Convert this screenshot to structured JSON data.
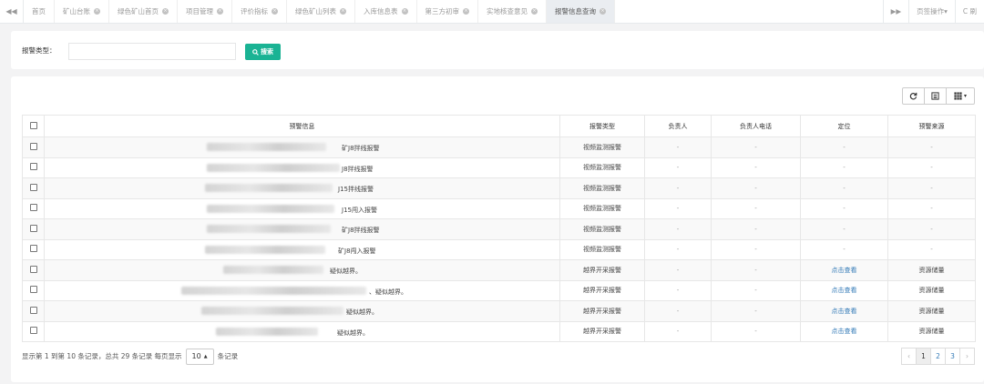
{
  "tabbar": {
    "nav_left_icon": "double-chevron-left-icon",
    "tabs": [
      {
        "label": "首页",
        "closable": false
      },
      {
        "label": "矿山台账",
        "closable": true
      },
      {
        "label": "绿色矿山首页",
        "closable": true
      },
      {
        "label": "项目管理",
        "closable": true
      },
      {
        "label": "评价指标",
        "closable": true
      },
      {
        "label": "绿色矿山列表",
        "closable": true
      },
      {
        "label": "入库信息表",
        "closable": true
      },
      {
        "label": "第三方初审",
        "closable": true
      },
      {
        "label": "实地核查意见",
        "closable": true
      },
      {
        "label": "报警信息查询",
        "closable": true,
        "active": true
      }
    ],
    "nav_right_icon": "double-chevron-right-icon",
    "page_ops_label": "页签操作▾",
    "refresh_label": "C 刷"
  },
  "search": {
    "label": "报警类型：",
    "input_value": "",
    "button_label": "搜索",
    "button_icon": "search-icon",
    "accent": "#1ab394"
  },
  "toolbar": {
    "refresh_icon": "refresh-icon",
    "toggle_icon": "list-toggle-icon",
    "columns_icon": "grid-columns-icon"
  },
  "table": {
    "headers": [
      "预警信息",
      "报警类型",
      "负责人",
      "负责人电话",
      "定位",
      "预警来源"
    ],
    "rows": [
      {
        "info": "矿J8拌线报警",
        "type": "视频监测报警",
        "person": "-",
        "phone": "-",
        "location": "-",
        "source": "-"
      },
      {
        "info": "J8拌线报警",
        "type": "视频监测报警",
        "person": "-",
        "phone": "-",
        "location": "-",
        "source": "-"
      },
      {
        "info": "J15拌线报警",
        "type": "视频监测报警",
        "person": "-",
        "phone": "-",
        "location": "-",
        "source": "-"
      },
      {
        "info": "J15闯入报警",
        "type": "视频监测报警",
        "person": "-",
        "phone": "-",
        "location": "-",
        "source": "-"
      },
      {
        "info": "矿J8拌线报警",
        "type": "视频监测报警",
        "person": "-",
        "phone": "-",
        "location": "-",
        "source": "-"
      },
      {
        "info": "矿J8闯入报警",
        "type": "视频监测报警",
        "person": "-",
        "phone": "-",
        "location": "-",
        "source": "-"
      },
      {
        "info": "疑似越界。",
        "type": "越界开采报警",
        "person": "-",
        "phone": "-",
        "location": "点击查看",
        "source": "资源储量"
      },
      {
        "info": "、疑似越界。",
        "type": "越界开采报警",
        "person": "-",
        "phone": "-",
        "location": "点击查看",
        "source": "资源储量"
      },
      {
        "info": "疑似越界。",
        "type": "越界开采报警",
        "person": "-",
        "phone": "-",
        "location": "点击查看",
        "source": "资源储量"
      },
      {
        "info": "疑似越界。",
        "type": "越界开采报警",
        "person": "-",
        "phone": "-",
        "location": "点击查看",
        "source": "资源储量"
      }
    ]
  },
  "footer": {
    "summary": "显示第 1 到第 10 条记录，总共 29 条记录 每页显示",
    "page_size": "10",
    "suffix": "条记录"
  },
  "pager": {
    "prev": "‹",
    "pages": [
      "1",
      "2",
      "3"
    ],
    "current": "1",
    "next": "›"
  }
}
